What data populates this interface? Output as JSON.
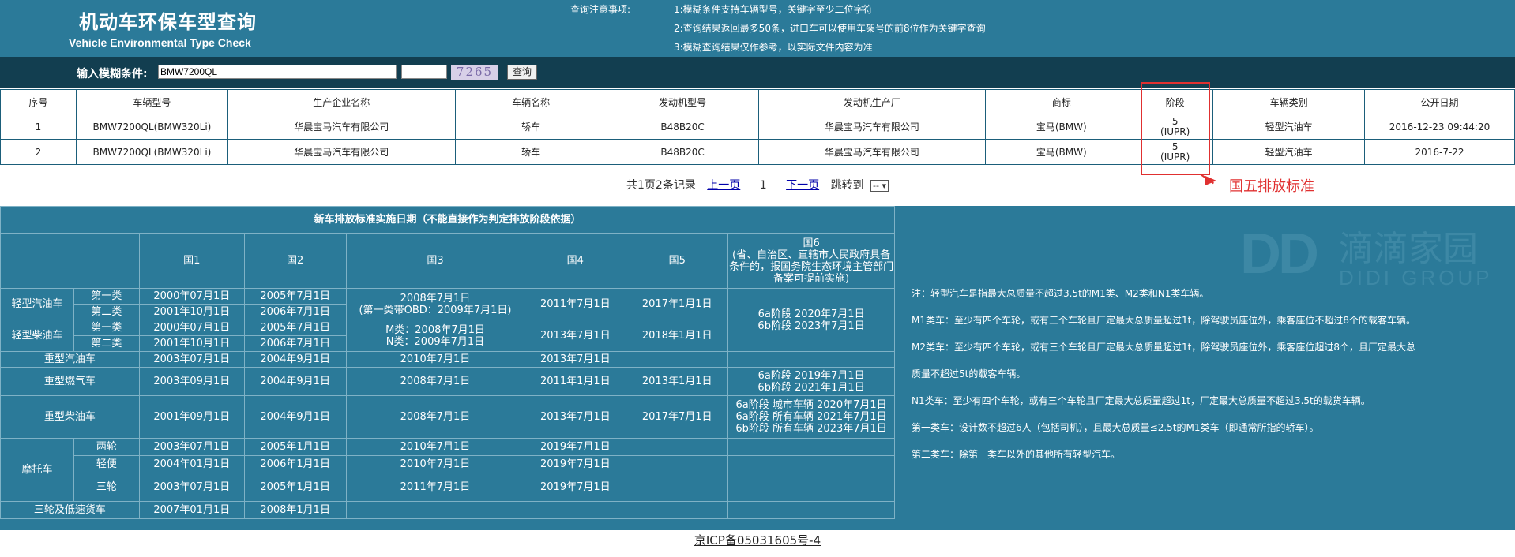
{
  "header": {
    "title_cn": "机动车环保车型查询",
    "title_en": "Vehicle Environmental Type Check",
    "notes_title": "查询注意事项:",
    "notes": [
      "1:模糊条件支持车辆型号，关键字至少二位字符",
      "2:查询结果返回最多50条，进口车可以使用车架号的前8位作为关键字查询",
      "3:模糊查询结果仅作参考，以实际文件内容为准"
    ]
  },
  "search": {
    "label": "输入模糊条件:",
    "value": "BMW7200QL",
    "captcha_input": "",
    "captcha": "7265",
    "button": "查询"
  },
  "results": {
    "headers": [
      "序号",
      "车辆型号",
      "生产企业名称",
      "车辆名称",
      "发动机型号",
      "发动机生产厂",
      "商标",
      "阶段",
      "车辆类别",
      "公开日期"
    ],
    "rows": [
      [
        "1",
        "BMW7200QL(BMW320Li)",
        "华晨宝马汽车有限公司",
        "轿车",
        "B48B20C",
        "华晨宝马汽车有限公司",
        "宝马(BMW)",
        "5",
        "(IUPR)",
        "轻型汽油车",
        "2016-12-23 09:44:20"
      ],
      [
        "2",
        "BMW7200QL(BMW320Li)",
        "华晨宝马汽车有限公司",
        "轿车",
        "B48B20C",
        "华晨宝马汽车有限公司",
        "宝马(BMW)",
        "5",
        "(IUPR)",
        "轻型汽油车",
        "2016-7-22"
      ]
    ]
  },
  "pager": {
    "summary": "共1页2条记录",
    "prev": "上一页",
    "current": "1",
    "next": "下一页",
    "jump_label": "跳转到",
    "jump_value": "-- ▾"
  },
  "annotation": {
    "text": "国五排放标准",
    "color": "#e03030"
  },
  "standards": {
    "title": "新车排放标准实施日期（不能直接作为判定排放阶段依据）",
    "col_headers": [
      "国1",
      "国2",
      "国3",
      "国4",
      "国5"
    ],
    "col6_header": [
      "国6",
      "(省、自治区、直辖市人民政府具备",
      "条件的，报国务院生态环境主管部门",
      "备案可提前实施)"
    ],
    "light_gas": "轻型汽油车",
    "light_diesel": "轻型柴油车",
    "class1": "第一类",
    "class2": "第二类",
    "lg1": [
      "2000年07月1日",
      "2005年7月1日"
    ],
    "lg2": [
      "2001年10月1日",
      "2006年7月1日"
    ],
    "lg_guo3": [
      "2008年7月1日",
      "(第一类带OBD：2009年7月1日)"
    ],
    "lg_guo4": "2011年7月1日",
    "lg_guo5": "2017年1月1日",
    "light_guo6": [
      "6a阶段 2020年7月1日",
      "6b阶段 2023年7月1日"
    ],
    "ld1": [
      "2000年07月1日",
      "2005年7月1日"
    ],
    "ld2": [
      "2001年10月1日",
      "2006年7月1日"
    ],
    "ld_guo3": [
      "M类：2008年7月1日",
      "N类：2009年7月1日"
    ],
    "ld_guo4": "2013年7月1日",
    "ld_guo5": "2018年1月1日",
    "heavy_gas": [
      "重型汽油车",
      "2003年07月1日",
      "2004年9月1日",
      "2010年7月1日",
      "2013年7月1日"
    ],
    "heavy_cng": [
      "重型燃气车",
      "2003年09月1日",
      "2004年9月1日",
      "2008年7月1日",
      "2011年1月1日",
      "2013年1月1日"
    ],
    "heavy_cng_guo6": [
      "6a阶段 2019年7月1日",
      "6b阶段 2021年1月1日"
    ],
    "heavy_diesel": [
      "重型柴油车",
      "2001年09月1日",
      "2004年9月1日",
      "2008年7月1日",
      "2013年7月1日",
      "2017年7月1日"
    ],
    "heavy_diesel_guo6": [
      "6a阶段 城市车辆 2020年7月1日",
      "6a阶段 所有车辆 2021年7月1日",
      "6b阶段 所有车辆 2023年7月1日"
    ],
    "moto": "摩托车",
    "moto_2w": [
      "两轮",
      "2003年07月1日",
      "2005年1月1日",
      "2010年7月1日",
      "2019年7月1日"
    ],
    "moto_light": [
      "轻便",
      "2004年01月1日",
      "2006年1月1日",
      "2010年7月1日",
      "2019年7月1日"
    ],
    "moto_3w": [
      "三轮",
      "2003年07月1日",
      "2005年1月1日",
      "2011年7月1日",
      "2019年7月1日"
    ],
    "tricycle": [
      "三轮及低速货车",
      "2007年01月1日",
      "2008年1月1日"
    ]
  },
  "std_notes": [
    "注：轻型汽车是指最大总质量不超过3.5t的M1类、M2类和N1类车辆。",
    "M1类车：至少有四个车轮，或有三个车轮且厂定最大总质量超过1t，除驾驶员座位外，乘客座位不超过8个的载客车辆。",
    "M2类车：至少有四个车轮，或有三个车轮且厂定最大总质量超过1t，除驾驶员座位外，乘客座位超过8个，且厂定最大总",
    "质量不超过5t的载客车辆。",
    "N1类车：至少有四个车轮，或有三个车轮且厂定最大总质量超过1t，厂定最大总质量不超过3.5t的载货车辆。",
    "第一类车：设计数不超过6人（包括司机），且最大总质量≤2.5t的M1类车（即通常所指的轿车）。",
    "第二类车：除第一类车以外的其他所有轻型汽车。"
  ],
  "watermark": {
    "dd": "DD",
    "cn": "滴滴家园",
    "en": "DIDI GROUP"
  },
  "footer": "京ICP备05031605号-4"
}
